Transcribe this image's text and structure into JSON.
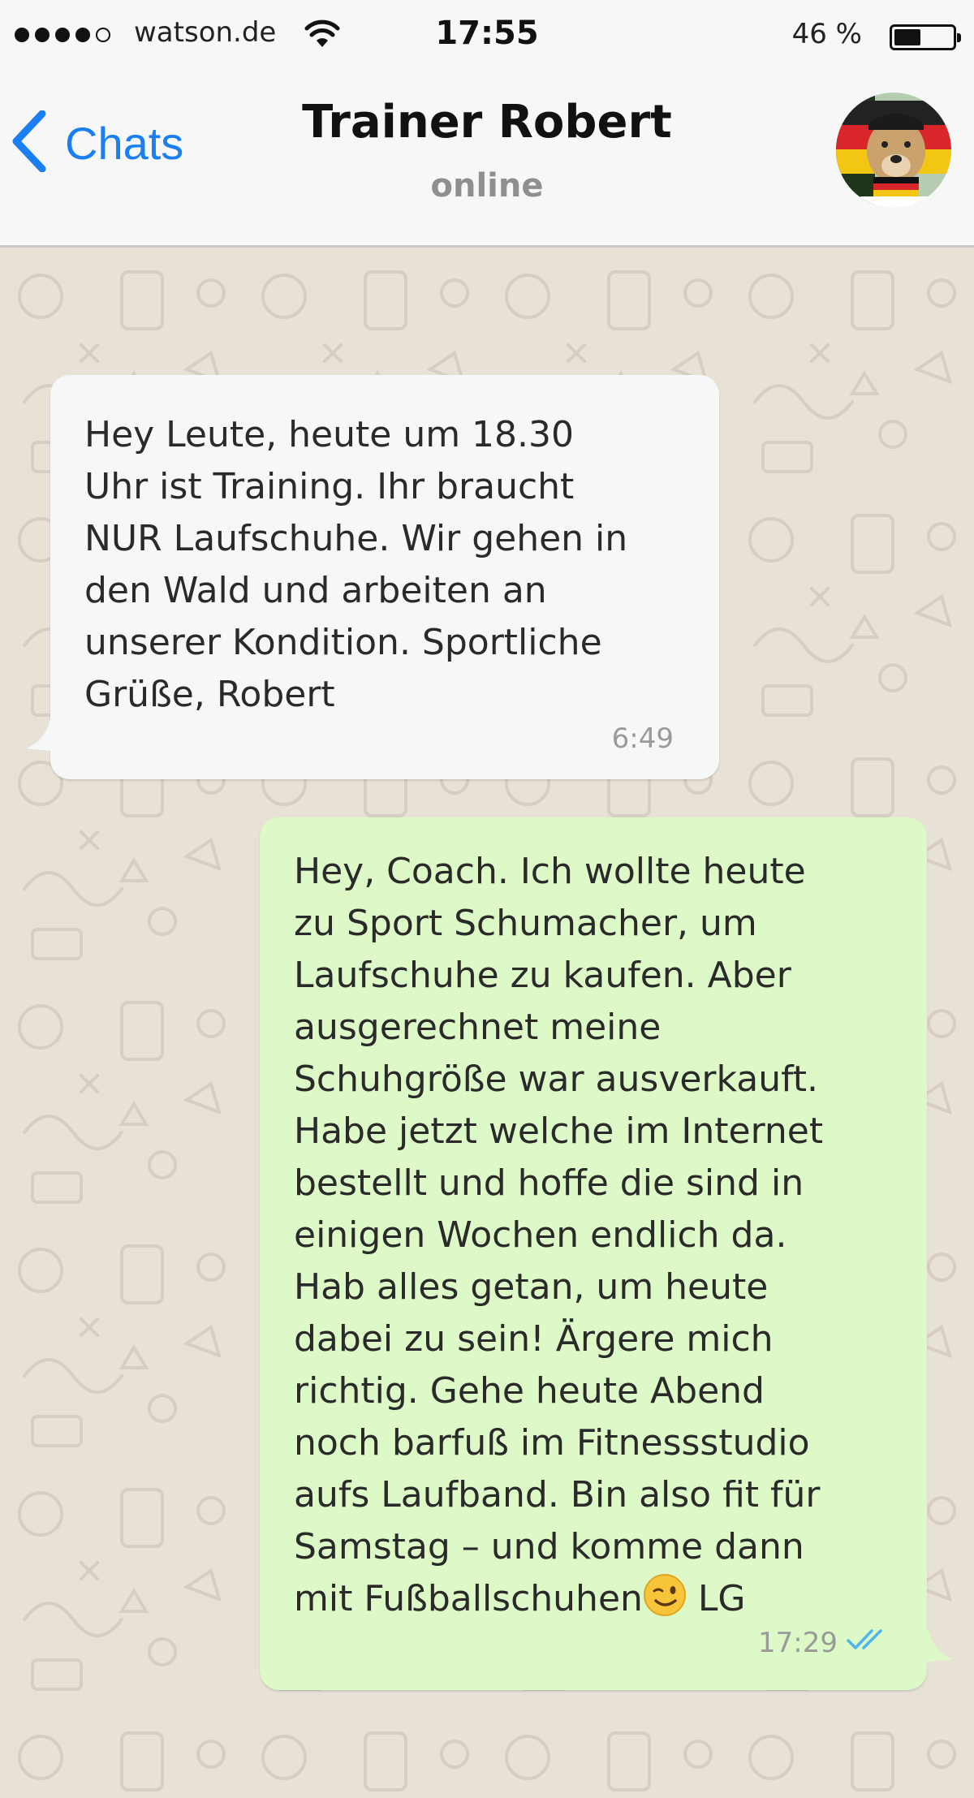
{
  "status_bar": {
    "carrier": "watson.de",
    "time": "17:55",
    "battery_percent_label": "46 %",
    "battery_level": 0.46
  },
  "header": {
    "back_label": "Chats",
    "contact_name": "Trainer Robert",
    "contact_status": "online"
  },
  "messages": [
    {
      "direction": "incoming",
      "text": "Hey Leute, heute um 18.30\nUhr ist Training. Ihr braucht\nNUR Laufschuhe. Wir gehen in\nden Wald und arbeiten an\nunserer Kondition. Sportliche\nGrüße, Robert",
      "time": "6:49"
    },
    {
      "direction": "outgoing",
      "text": "Hey, Coach. Ich wollte heute\nzu Sport Schumacher, um\nLaufschuhe zu kaufen. Aber\nausgerechnet meine\nSchuhgröße war ausverkauft.\nHabe jetzt welche im Internet\nbestellt und hoffe die sind in\neinigen Wochen endlich da.\nHab alles getan, um heute\ndabei zu sein! Ärgere mich\nrichtig. Gehe heute Abend\nnoch barfuß im Fitnessstudio\naufs Laufband. Bin also fit für\nSamstag – und komme dann\nmit Fußballschuhen",
      "text_after_emoji": " LG",
      "emoji": "winking-face-emoji",
      "time": "17:29",
      "receipt": "double-check-read-icon"
    }
  ],
  "colors": {
    "ios_blue": "#1a7ff2",
    "incoming_bubble": "#f6f7f9",
    "outgoing_bubble": "#dcf9c7",
    "read_receipt": "#4fb6ec",
    "chat_background": "#e8e1d6"
  }
}
